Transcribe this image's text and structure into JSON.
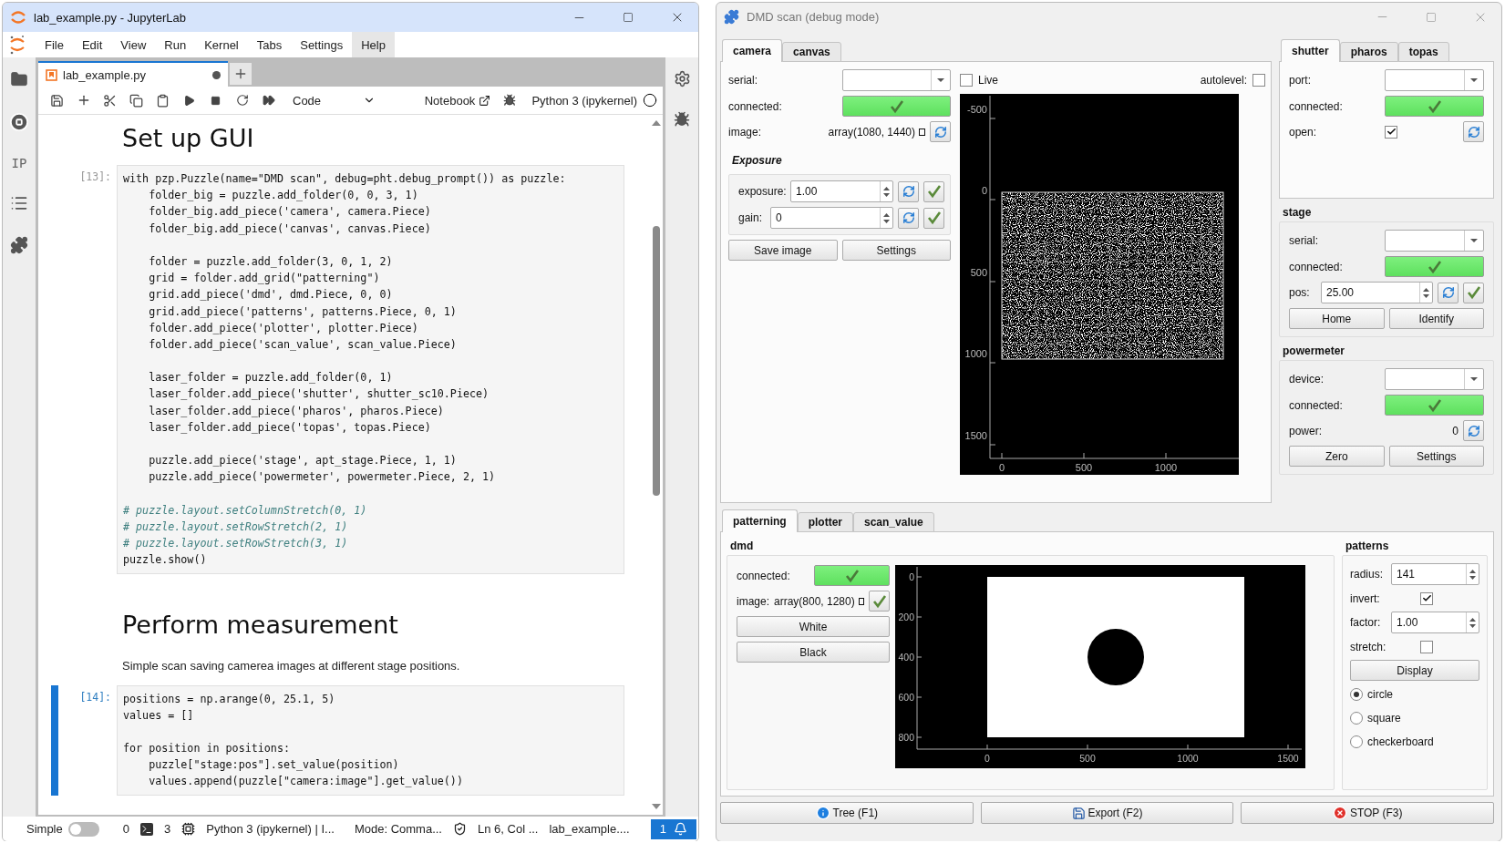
{
  "jupyter": {
    "window": {
      "title": "lab_example.py - JupyterLab"
    },
    "menu": [
      {
        "label": "File",
        "selected": false
      },
      {
        "label": "Edit",
        "selected": false
      },
      {
        "label": "View",
        "selected": false
      },
      {
        "label": "Run",
        "selected": false
      },
      {
        "label": "Kernel",
        "selected": false
      },
      {
        "label": "Tabs",
        "selected": false
      },
      {
        "label": "Settings",
        "selected": false
      },
      {
        "label": "Help",
        "selected": true
      }
    ],
    "left_sidebar_text": "IP",
    "tab": {
      "label": "lab_example.py",
      "modified": true
    },
    "toolbar": {
      "cell_type": "Code",
      "notebook_label": "Notebook",
      "kernel": "Python 3 (ipykernel)"
    },
    "cells": [
      {
        "kind": "heading",
        "text": "Set up GUI"
      },
      {
        "kind": "code",
        "prompt": "[13]:",
        "active": false,
        "lines": [
          {
            "kind": "code",
            "text": "with pzp.Puzzle(name=\"DMD scan\", debug=pht.debug_prompt()) as puzzle:"
          },
          {
            "kind": "code",
            "text": "    folder_big = puzzle.add_folder(0, 0, 3, 1)"
          },
          {
            "kind": "code",
            "text": "    folder_big.add_piece('camera', camera.Piece)"
          },
          {
            "kind": "code",
            "text": "    folder_big.add_piece('canvas', canvas.Piece)"
          },
          {
            "kind": "blank"
          },
          {
            "kind": "code",
            "text": "    folder = puzzle.add_folder(3, 0, 1, 2)"
          },
          {
            "kind": "code",
            "text": "    grid = folder.add_grid(\"patterning\")"
          },
          {
            "kind": "code",
            "text": "    grid.add_piece('dmd', dmd.Piece, 0, 0)"
          },
          {
            "kind": "code",
            "text": "    grid.add_piece('patterns', patterns.Piece, 0, 1)"
          },
          {
            "kind": "code",
            "text": "    folder.add_piece('plotter', plotter.Piece)"
          },
          {
            "kind": "code",
            "text": "    folder.add_piece('scan_value', scan_value.Piece)"
          },
          {
            "kind": "blank"
          },
          {
            "kind": "code",
            "text": "    laser_folder = puzzle.add_folder(0, 1)"
          },
          {
            "kind": "code",
            "text": "    laser_folder.add_piece('shutter', shutter_sc10.Piece)"
          },
          {
            "kind": "code",
            "text": "    laser_folder.add_piece('pharos', pharos.Piece)"
          },
          {
            "kind": "code",
            "text": "    laser_folder.add_piece('topas', topas.Piece)"
          },
          {
            "kind": "blank"
          },
          {
            "kind": "code",
            "text": "    puzzle.add_piece('stage', apt_stage.Piece, 1, 1)"
          },
          {
            "kind": "code",
            "text": "    puzzle.add_piece('powermeter', powermeter.Piece, 2, 1)"
          },
          {
            "kind": "blank"
          },
          {
            "kind": "comment",
            "text": "# puzzle.layout.setColumnStretch(0, 1)"
          },
          {
            "kind": "comment",
            "text": "# puzzle.layout.setRowStretch(2, 1)"
          },
          {
            "kind": "comment",
            "text": "# puzzle.layout.setRowStretch(3, 1)"
          },
          {
            "kind": "code",
            "text": "puzzle.show()"
          }
        ]
      },
      {
        "kind": "heading",
        "text": "Perform measurement"
      },
      {
        "kind": "text",
        "text": "Simple scan saving camerea images at different stage positions."
      },
      {
        "kind": "code",
        "prompt": "[14]:",
        "active": true,
        "lines": [
          {
            "kind": "code",
            "text": "positions = np.arange(0, 25.1, 5)"
          },
          {
            "kind": "code",
            "text": "values = []"
          },
          {
            "kind": "blank"
          },
          {
            "kind": "code",
            "text": "for position in positions:"
          },
          {
            "kind": "code",
            "text": "    puzzle[\"stage:pos\"].set_value(position)"
          },
          {
            "kind": "code",
            "text": "    values.append(puzzle[\"camera:image\"].get_value())"
          }
        ]
      }
    ],
    "status_bar": {
      "mode_label": "Simple",
      "simple_on": false,
      "terminals": "0",
      "kernels": "3",
      "kernel": "Python 3 (ipykernel) | I...",
      "mode": "Mode: Comma...",
      "position": "Ln 6, Col ...",
      "file": "lab_example....",
      "notifications": "1"
    }
  },
  "dmd_window": {
    "title": "DMD scan (debug mode)",
    "camera_tabs": [
      {
        "label": "camera",
        "selected": true
      },
      {
        "label": "canvas",
        "selected": false
      }
    ],
    "camera_rows": [
      {
        "kind": "combo",
        "label": "serial:"
      },
      {
        "kind": "led",
        "label": "connected:",
        "on": true
      },
      {
        "kind": "readout",
        "label": "image:",
        "value": "array(1080, 1440)",
        "refresh": true
      }
    ],
    "exposure": {
      "title": "Exposure",
      "rows": [
        {
          "kind": "spin",
          "label": "exposure:",
          "value": "1.00",
          "refresh": true,
          "apply": true
        },
        {
          "kind": "spin",
          "label": "gain:",
          "value": "0",
          "refresh": true,
          "apply": true
        }
      ]
    },
    "camera_buttons": {
      "kind": "buttons",
      "buttons": [
        "Save image",
        "Settings"
      ]
    },
    "live": {
      "label": "Live",
      "checked": false
    },
    "autolevel": {
      "label": "autolevel:",
      "checked": false
    },
    "camera_plot": {
      "y_ticks": [
        "-500",
        "0",
        "500",
        "1000",
        "1500"
      ],
      "x_ticks": [
        "0",
        "500",
        "1000"
      ]
    },
    "laser_tabs": [
      {
        "label": "shutter",
        "selected": true
      },
      {
        "label": "pharos",
        "selected": false
      },
      {
        "label": "topas",
        "selected": false
      }
    ],
    "shutter_rows": [
      {
        "kind": "combo",
        "label": "port:"
      },
      {
        "kind": "led",
        "label": "connected:",
        "on": true
      },
      {
        "kind": "checkbox",
        "label": "open:",
        "checked": true,
        "refresh": true
      }
    ],
    "stage": {
      "title": "stage",
      "rows": [
        {
          "kind": "combo",
          "label": "serial:"
        },
        {
          "kind": "led",
          "label": "connected:",
          "on": true
        },
        {
          "kind": "spin",
          "label": "pos:",
          "value": "25.00",
          "refresh": true,
          "apply": true
        },
        {
          "kind": "buttons",
          "buttons": [
            "Home",
            "Identify"
          ]
        }
      ]
    },
    "powermeter": {
      "title": "powermeter",
      "rows": [
        {
          "kind": "combo",
          "label": "device:"
        },
        {
          "kind": "led",
          "label": "connected:",
          "on": true
        },
        {
          "kind": "readout",
          "label": "power:",
          "value": "0",
          "refresh": true
        },
        {
          "kind": "buttons",
          "buttons": [
            "Zero",
            "Settings"
          ]
        }
      ]
    },
    "bottom_tabs": [
      {
        "label": "patterning",
        "selected": true
      },
      {
        "label": "plotter",
        "selected": false
      },
      {
        "label": "scan_value",
        "selected": false
      }
    ],
    "dmd": {
      "title": "dmd",
      "rows": [
        {
          "kind": "led",
          "label": "connected:",
          "on": true
        },
        {
          "kind": "readout",
          "label": "image:",
          "value": "array(800, 1280)",
          "apply": true
        },
        {
          "kind": "buttons",
          "buttons": [
            "White"
          ]
        },
        {
          "kind": "buttons",
          "buttons": [
            "Black"
          ]
        }
      ],
      "plot": {
        "y_ticks": [
          "0",
          "200",
          "400",
          "600",
          "800"
        ],
        "x_ticks": [
          "0",
          "500",
          "1000",
          "1500"
        ]
      }
    },
    "patterns": {
      "title": "patterns",
      "rows": [
        {
          "kind": "spin",
          "label": "radius:",
          "value": "141"
        },
        {
          "kind": "checkbox",
          "label": "invert:",
          "checked": true
        },
        {
          "kind": "spin",
          "label": "factor:",
          "value": "1.00"
        },
        {
          "kind": "checkbox",
          "label": "stretch:",
          "checked": false
        },
        {
          "kind": "buttons",
          "buttons": [
            "Display"
          ]
        },
        {
          "kind": "radio",
          "label": "circle",
          "selected": true
        },
        {
          "kind": "radio",
          "label": "square",
          "selected": false
        },
        {
          "kind": "radio",
          "label": "checkerboard",
          "selected": false
        }
      ]
    },
    "footer_buttons": [
      {
        "kind": "info",
        "label": "Tree (F1)"
      },
      {
        "kind": "save",
        "label": "Export (F2)"
      },
      {
        "kind": "stop",
        "label": "STOP (F3)"
      }
    ]
  }
}
